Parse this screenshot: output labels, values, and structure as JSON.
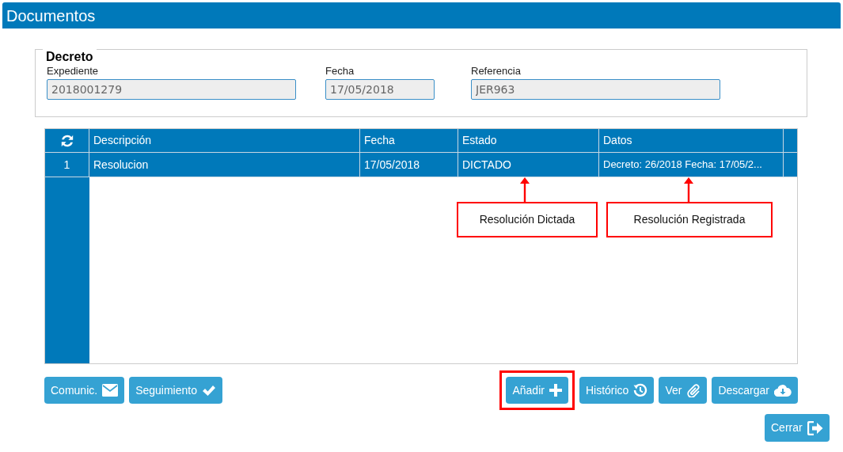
{
  "window": {
    "title": "Documentos"
  },
  "decreto": {
    "legend": "Decreto",
    "fields": [
      {
        "label": "Expediente",
        "value": "2018001279"
      },
      {
        "label": "Fecha",
        "value": "17/05/2018"
      },
      {
        "label": "Referencia",
        "value": "JER963"
      }
    ]
  },
  "table": {
    "columns": [
      "Descripción",
      "Fecha",
      "Estado",
      "Datos"
    ],
    "rows": [
      {
        "index": "1",
        "cells": [
          "Resolucion",
          "17/05/2018",
          "DICTADO",
          "Decreto: 26/2018 Fecha: 17/05/2..."
        ],
        "selected": true
      }
    ]
  },
  "annotations": [
    {
      "text": "Resolución Dictada"
    },
    {
      "text": "Resolución Registrada"
    }
  ],
  "left_buttons": [
    {
      "label": "Comunic.",
      "highlighted": false
    },
    {
      "label": "Seguimiento",
      "highlighted": false
    }
  ],
  "right_buttons": [
    {
      "label": "Añadir",
      "highlighted": true
    },
    {
      "label": "Histórico",
      "highlighted": false
    },
    {
      "label": "Ver",
      "highlighted": false
    },
    {
      "label": "Descargar",
      "highlighted": false
    }
  ],
  "close_button": {
    "label": "Cerrar"
  }
}
